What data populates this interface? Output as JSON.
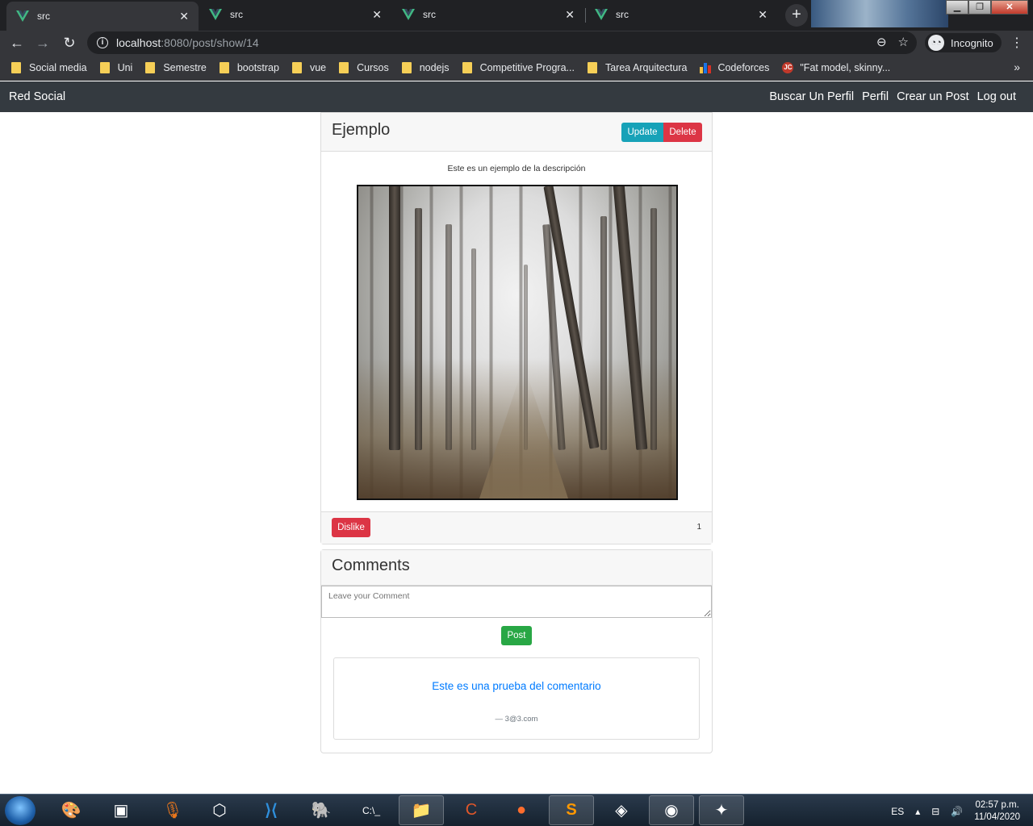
{
  "browser": {
    "tabs": [
      {
        "label": "src",
        "active": true
      },
      {
        "label": "src",
        "active": false
      },
      {
        "label": "src",
        "active": false
      },
      {
        "label": "src",
        "active": false
      }
    ],
    "url_host": "localhost",
    "url_rest": ":8080/post/show/14",
    "incognito_label": "Incognito",
    "bookmarks": [
      {
        "label": "Social media",
        "icon": "folder-icon"
      },
      {
        "label": "Uni",
        "icon": "folder-icon"
      },
      {
        "label": "Semestre",
        "icon": "folder-icon"
      },
      {
        "label": "bootstrap",
        "icon": "folder-icon"
      },
      {
        "label": "vue",
        "icon": "folder-icon"
      },
      {
        "label": "Cursos",
        "icon": "folder-icon"
      },
      {
        "label": "nodejs",
        "icon": "folder-icon"
      },
      {
        "label": "Competitive Progra...",
        "icon": "folder-icon"
      },
      {
        "label": "Tarea Arquitectura",
        "icon": "folder-icon"
      },
      {
        "label": "Codeforces",
        "icon": "codeforces-icon"
      },
      {
        "label": "\"Fat model, skinny...",
        "icon": "jc-icon"
      }
    ]
  },
  "app": {
    "brand": "Red Social",
    "nav": [
      "Buscar Un Perfil",
      "Perfil",
      "Crear un Post",
      "Log out"
    ]
  },
  "post": {
    "title": "Ejemplo",
    "update_label": "Update",
    "delete_label": "Delete",
    "description": "Este es un ejemplo de la descripción",
    "dislike_label": "Dislike",
    "count": "1"
  },
  "comments": {
    "title": "Comments",
    "placeholder": "Leave your Comment",
    "post_label": "Post",
    "items": [
      {
        "text": "Este es una prueba del comentario",
        "author": "— 3@3.com"
      }
    ]
  },
  "taskbar": {
    "language": "ES",
    "time": "02:57 p.m.",
    "date": "11/04/2020"
  },
  "colors": {
    "navbar": "#343a40",
    "info": "#17a2b8",
    "danger": "#dc3545",
    "success": "#28a745",
    "link": "#007bff"
  }
}
